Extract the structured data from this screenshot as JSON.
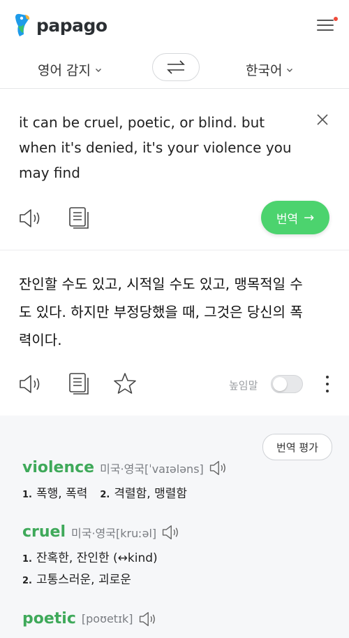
{
  "header": {
    "logo_text": "papago"
  },
  "langbar": {
    "source_lang": "영어 감지",
    "target_lang": "한국어"
  },
  "source": {
    "text": "it can be cruel, poetic, or blind. but when it's denied, it's your violence you may find",
    "translate_label": "번역",
    "translate_arrow": "→"
  },
  "target": {
    "text": "잔인할 수도 있고, 시적일 수도 있고, 맹목적일 수도 있다. 하지만 부정당했을 때, 그것은 당신의 폭력이다.",
    "honorific_label": "높임말"
  },
  "dictionary": {
    "eval_label": "번역 평가",
    "entries": [
      {
        "word": "violence",
        "pron": "미국·영국[ˈvaɪələns]",
        "senses": [
          "폭행, 폭력",
          "격렬함, 맹렬함"
        ]
      },
      {
        "word": "cruel",
        "pron": "미국·영국[kruːəl]",
        "senses": [
          "잔혹한, 잔인한 (↔kind)",
          "고통스러운, 괴로운"
        ]
      },
      {
        "word": "poetic",
        "pron": "[poʊetɪk]"
      }
    ],
    "sense_numbers": [
      "1.",
      "2."
    ]
  },
  "colors": {
    "accent_green": "#4cd36e",
    "dict_word_green": "#3fa95a",
    "notification_red": "#f04a3a"
  },
  "icons": [
    "papago-logo-icon",
    "menu-icon",
    "chevron-down-icon",
    "swap-icon",
    "close-icon",
    "speaker-icon",
    "copy-icon",
    "star-icon",
    "more-vertical-icon"
  ]
}
